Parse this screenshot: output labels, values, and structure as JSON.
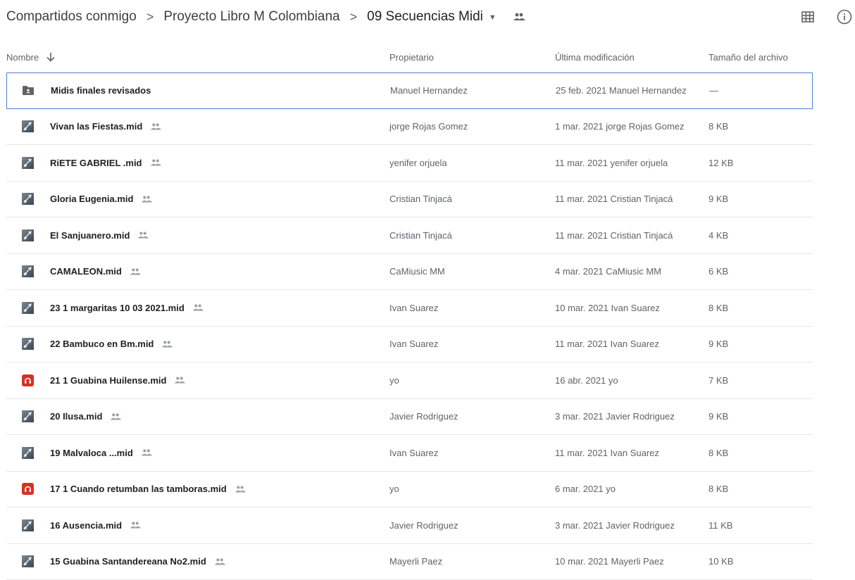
{
  "breadcrumb": {
    "items": [
      "Compartidos conmigo",
      "Proyecto Libro M Colombiana",
      "09 Secuencias Midi"
    ],
    "separator": ">",
    "dropdown_glyph": "▼"
  },
  "toolbar": {
    "icons": [
      "grid-view-icon",
      "info-icon"
    ]
  },
  "table": {
    "headers": {
      "name": "Nombre",
      "owner": "Propietario",
      "modified": "Última modificación",
      "size": "Tamaño del archivo"
    },
    "sort": "descending",
    "rows": [
      {
        "type": "shared-folder",
        "name": "Midis finales revisados",
        "owner": "Manuel Hernandez",
        "modified": "25 feb. 2021  Manuel Hernandez",
        "size": "—",
        "shared": false,
        "selected": true
      },
      {
        "type": "midi",
        "name": "Vivan las Fiestas.mid",
        "owner": "jorge Rojas Gomez",
        "modified": "1 mar. 2021  jorge Rojas Gomez",
        "size": "8 KB",
        "shared": true
      },
      {
        "type": "midi",
        "name": "RiETE GABRIEL .mid",
        "owner": "yenifer orjuela",
        "modified": "11 mar. 2021  yenifer orjuela",
        "size": "12 KB",
        "shared": true
      },
      {
        "type": "midi",
        "name": "Gloria Eugenia.mid",
        "owner": "Cristian Tinjacá",
        "modified": "11 mar. 2021  Cristian Tinjacá",
        "size": "9 KB",
        "shared": true
      },
      {
        "type": "midi",
        "name": "El Sanjuanero.mid",
        "owner": "Cristian Tinjacá",
        "modified": "11 mar. 2021  Cristian Tinjacá",
        "size": "4 KB",
        "shared": true
      },
      {
        "type": "midi",
        "name": "CAMALEON.mid",
        "owner": "CaMiusic MM",
        "modified": "4 mar. 2021  CaMiusic MM",
        "size": "6 KB",
        "shared": true
      },
      {
        "type": "midi",
        "name": "23  1 margaritas  10 03 2021.mid",
        "owner": "Ivan Suarez",
        "modified": "10 mar. 2021  Ivan Suarez",
        "size": "8 KB",
        "shared": true
      },
      {
        "type": "midi",
        "name": "22 Bambuco en Bm.mid",
        "owner": "Ivan Suarez",
        "modified": "11 mar. 2021  Ivan Suarez",
        "size": "9 KB",
        "shared": true
      },
      {
        "type": "audio-app",
        "name": "21 1 Guabina Huilense.mid",
        "owner": "yo",
        "modified": "16 abr. 2021  yo",
        "size": "7 KB",
        "shared": true
      },
      {
        "type": "midi",
        "name": "20 Ilusa.mid",
        "owner": "Javier Rodriguez",
        "modified": "3 mar. 2021  Javier Rodriguez",
        "size": "9 KB",
        "shared": true
      },
      {
        "type": "midi",
        "name": "19 Malvaloca ...mid",
        "owner": "Ivan Suarez",
        "modified": "11 mar. 2021  Ivan Suarez",
        "size": "8 KB",
        "shared": true
      },
      {
        "type": "audio-app",
        "name": "17 1 Cuando retumban las tamboras.mid",
        "owner": "yo",
        "modified": "6 mar. 2021  yo",
        "size": "8 KB",
        "shared": true
      },
      {
        "type": "midi",
        "name": "16 Ausencia.mid",
        "owner": "Javier Rodriguez",
        "modified": "3 mar. 2021  Javier Rodriguez",
        "size": "11 KB",
        "shared": true
      },
      {
        "type": "midi",
        "name": "15  Guabina Santandereana No2.mid",
        "owner": "Mayerli Paez",
        "modified": "10 mar. 2021  Mayerli Paez",
        "size": "10 KB",
        "shared": true
      }
    ]
  },
  "colors": {
    "selection_border": "#4a7dd6",
    "audio_app_red": "#d93025",
    "secondary_text": "#5f6368"
  }
}
